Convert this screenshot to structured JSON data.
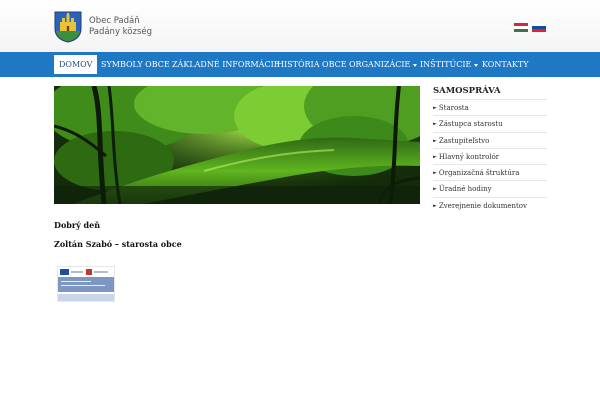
{
  "header": {
    "site_name_line1": "Obec Padáň",
    "site_name_line2": "Padány község",
    "crest_icon": "municipal-crest-icon",
    "languages": [
      {
        "name": "hungarian-flag-icon",
        "colors": [
          "#cd2a3e",
          "#ffffff",
          "#436f4d"
        ]
      },
      {
        "name": "slovak-flag-icon",
        "colors": [
          "#ffffff",
          "#0b4ea2",
          "#ee1c25"
        ]
      }
    ]
  },
  "nav": {
    "items": [
      {
        "label": "DOMOV",
        "active": true
      },
      {
        "label": "SYMBOLY OBCE"
      },
      {
        "label": "ZÁKLADNÉ INFORMÁCIE"
      },
      {
        "label": "HISTÓRIA OBCE"
      },
      {
        "label": "ORGANIZÁCIE",
        "dropdown": true
      },
      {
        "label": "INŠTITÚCIE",
        "dropdown": true
      },
      {
        "label": "KONTAKTY"
      }
    ]
  },
  "sidebar": {
    "title": "SAMOSPRÁVA",
    "items": [
      {
        "label": "Starosta"
      },
      {
        "label": "Zástupca starostu"
      },
      {
        "label": "Zastupiteľstvo"
      },
      {
        "label": "Hlavný kontrolór"
      },
      {
        "label": "Organizačná štruktúra"
      },
      {
        "label": "Úradné hodiny"
      },
      {
        "label": "Zverejnenie dokumentov"
      }
    ]
  },
  "main": {
    "greeting": "Dobrý deň",
    "mayor_line": "Zoltán Szabó – starosta obce",
    "banner_image": "river-landscape-photo",
    "document_thumbnail": "eu-project-document-thumbnail"
  },
  "colors": {
    "nav_background": "#1f78c3",
    "nav_active_text": "#1f4f86"
  }
}
